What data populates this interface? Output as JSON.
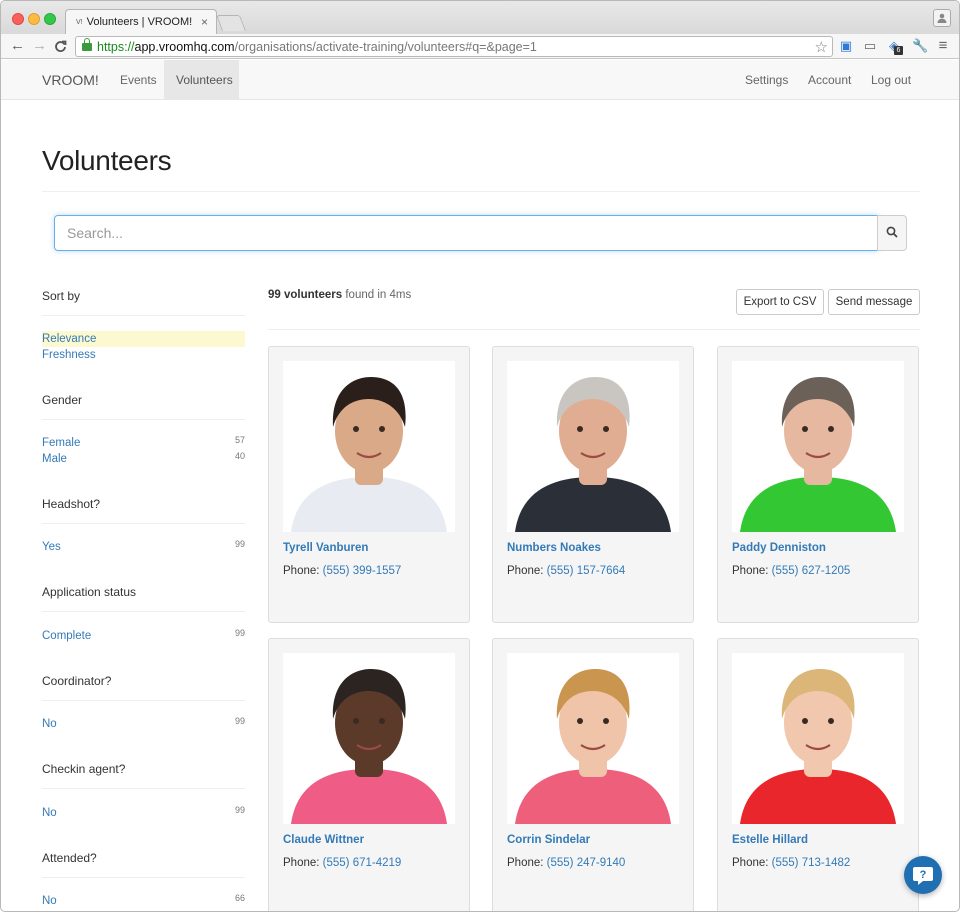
{
  "browser": {
    "tab_title": "Volunteers | VROOM!",
    "favicon_text": "V!",
    "url_scheme": "https://",
    "url_host": "app.vroomhq.com",
    "url_path": "/organisations/activate-training/volunteers#q=&page=1",
    "extension_badge": "6"
  },
  "nav": {
    "brand": "VROOM!",
    "left": [
      "Events",
      "Volunteers"
    ],
    "active": "Volunteers",
    "right": [
      "Settings",
      "Account",
      "Log out"
    ]
  },
  "page": {
    "title": "Volunteers",
    "search_placeholder": "Search..."
  },
  "sidebar": {
    "sort_title": "Sort by",
    "sort_options": [
      "Relevance",
      "Freshness"
    ],
    "sort_selected": "Relevance",
    "facets": [
      {
        "title": "Gender",
        "items": [
          {
            "label": "Female",
            "count": "57"
          },
          {
            "label": "Male",
            "count": "40"
          }
        ]
      },
      {
        "title": "Headshot?",
        "items": [
          {
            "label": "Yes",
            "count": "99"
          }
        ]
      },
      {
        "title": "Application status",
        "items": [
          {
            "label": "Complete",
            "count": "99"
          }
        ]
      },
      {
        "title": "Coordinator?",
        "items": [
          {
            "label": "No",
            "count": "99"
          }
        ]
      },
      {
        "title": "Checkin agent?",
        "items": [
          {
            "label": "No",
            "count": "99"
          }
        ]
      },
      {
        "title": "Attended?",
        "items": [
          {
            "label": "No",
            "count": "66"
          }
        ]
      }
    ]
  },
  "results": {
    "count_text": "99 volunteers",
    "found_text": "found in 4ms",
    "export_label": "Export to CSV",
    "message_label": "Send message"
  },
  "phone_label": "Phone:",
  "volunteers": [
    {
      "name": "Tyrell Vanburen",
      "phone": "(555) 399-1557",
      "shirt": "#e8ecf2",
      "skin": "#d9a988",
      "hair": "#2a1f1a"
    },
    {
      "name": "Numbers Noakes",
      "phone": "(555) 157-7664",
      "shirt": "#2b2f38",
      "skin": "#e0ad92",
      "hair": "#c9c6c2"
    },
    {
      "name": "Paddy Denniston",
      "phone": "(555) 627-1205",
      "shirt": "#33c733",
      "skin": "#e7b8a0",
      "hair": "#6b6159"
    },
    {
      "name": "Claude Wittner",
      "phone": "(555) 671-4219",
      "shirt": "#ef5c85",
      "skin": "#5b3a2a",
      "hair": "#2b2420"
    },
    {
      "name": "Corrin Sindelar",
      "phone": "(555) 247-9140",
      "shirt": "#ee5f7c",
      "skin": "#efc4a9",
      "hair": "#c9954f"
    },
    {
      "name": "Estelle Hillard",
      "phone": "(555) 713-1482",
      "shirt": "#e8262c",
      "skin": "#f1c7ae",
      "hair": "#dcb678"
    }
  ],
  "colors": {
    "link": "#337ab7",
    "selected_highlight": "#fcf8cf",
    "help_button": "#1f6fb2"
  }
}
